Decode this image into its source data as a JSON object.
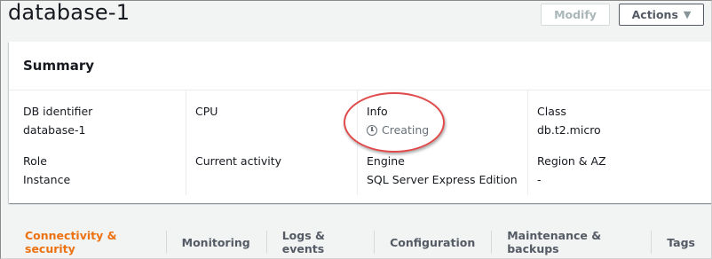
{
  "page": {
    "title": "database-1"
  },
  "header_buttons": {
    "modify_label": "Modify",
    "actions_label": "Actions",
    "actions_caret_icon": "caret-down-icon"
  },
  "summary": {
    "heading": "Summary",
    "fields": {
      "db_identifier": {
        "label": "DB identifier",
        "value": "database-1"
      },
      "cpu": {
        "label": "CPU",
        "value": ""
      },
      "info": {
        "label": "Info",
        "value": "Creating",
        "icon": "clock-icon"
      },
      "class": {
        "label": "Class",
        "value": "db.t2.micro"
      },
      "role": {
        "label": "Role",
        "value": "Instance"
      },
      "current_activity": {
        "label": "Current activity",
        "value": ""
      },
      "engine": {
        "label": "Engine",
        "value": "SQL Server Express Edition"
      },
      "region_az": {
        "label": "Region & AZ",
        "value": "-"
      }
    }
  },
  "tabs": [
    {
      "label": "Connectivity & security",
      "active": true
    },
    {
      "label": "Monitoring",
      "active": false
    },
    {
      "label": "Logs & events",
      "active": false
    },
    {
      "label": "Configuration",
      "active": false
    },
    {
      "label": "Maintenance & backups",
      "active": false
    },
    {
      "label": "Tags",
      "active": false
    }
  ],
  "colors": {
    "accent": "#ec7211",
    "annotation": "#e04a4a",
    "muted_text": "#687078"
  }
}
